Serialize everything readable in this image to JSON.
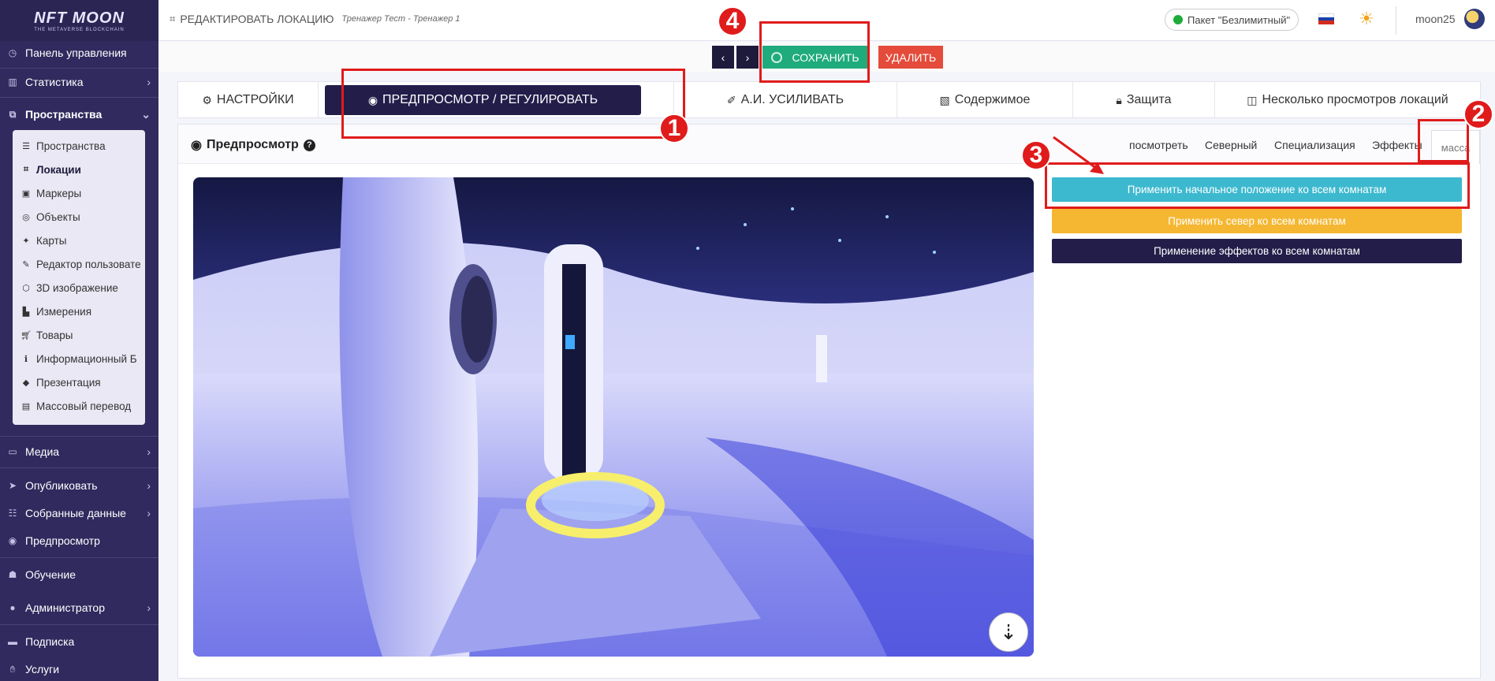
{
  "logo": {
    "main": "NFT MOON",
    "sub": "THE METAVERSE BLOCKCHAIN"
  },
  "sidebar": {
    "items": [
      {
        "label": "Панель управления",
        "icon": "dashboard-icon"
      },
      {
        "label": "Статистика",
        "icon": "chart-icon"
      },
      {
        "label": "Пространства",
        "icon": "sitemap-icon"
      },
      {
        "label": "Медиа",
        "icon": "monitor-icon"
      },
      {
        "label": "Опубликовать",
        "icon": "paper-plane-icon"
      },
      {
        "label": "Собранные данные",
        "icon": "database-icon"
      },
      {
        "label": "Предпросмотр",
        "icon": "eye-icon"
      },
      {
        "label": "Обучение",
        "icon": "users-icon"
      },
      {
        "label": "Администратор",
        "icon": "user-icon"
      },
      {
        "label": "Подписка",
        "icon": "card-icon"
      },
      {
        "label": "Услуги",
        "icon": "hand-icon"
      }
    ],
    "submenu": [
      {
        "label": "Пространства",
        "icon": "list-icon"
      },
      {
        "label": "Локации",
        "icon": "location-icon"
      },
      {
        "label": "Маркеры",
        "icon": "image-icon"
      },
      {
        "label": "Объекты",
        "icon": "circle-icon"
      },
      {
        "label": "Карты",
        "icon": "map-icon"
      },
      {
        "label": "Редактор пользовате",
        "icon": "edit-icon"
      },
      {
        "label": "3D изображение",
        "icon": "cube-icon"
      },
      {
        "label": "Измерения",
        "icon": "ruler-icon"
      },
      {
        "label": "Товары",
        "icon": "cart-icon"
      },
      {
        "label": "Информационный Б",
        "icon": "info-icon"
      },
      {
        "label": "Презентация",
        "icon": "diamond-icon"
      },
      {
        "label": "Массовый перевод",
        "icon": "id-card-icon"
      }
    ]
  },
  "header": {
    "title": "РЕДАКТИРОВАТЬ ЛОКАЦИЮ",
    "subtitle": "Тренажер Тест - Тренажер 1",
    "package": "Пакет \"Безлимитный\"",
    "username": "moon25"
  },
  "actions": {
    "prev": "‹",
    "next": "›",
    "save": "СОХРАНИТЬ",
    "delete": "УДАЛИТЬ"
  },
  "tabs": [
    {
      "label": "НАСТРОЙКИ",
      "icon": "cogs-icon"
    },
    {
      "label": "ПРЕДПРОСМОТР / РЕГУЛИРОВАТЬ",
      "icon": "eye-icon"
    },
    {
      "label": "А.И. УСИЛИВАТЬ",
      "icon": "magic-brush-icon"
    },
    {
      "label": "Содержимое",
      "icon": "images-icon"
    },
    {
      "label": "Защита",
      "icon": "lock-icon"
    },
    {
      "label": "Несколько просмотров локаций",
      "icon": "columns-icon"
    }
  ],
  "panel": {
    "title": "Предпросмотр",
    "subtabs": [
      "посмотреть",
      "Северный",
      "Специализация",
      "Эффекты",
      "масса"
    ]
  },
  "mass_buttons": [
    "Применить начальное положение ко всем комнатам",
    "Применить север ко всем комнатам",
    "Применение эффектов ко всем комнатам"
  ],
  "annotations": [
    "1",
    "2",
    "3",
    "4"
  ],
  "colors": {
    "sidebar": "#312a5e",
    "primary_dark": "#231d4a",
    "save_green": "#1fab7b",
    "delete_red": "#e44b3a",
    "teal": "#3db9cf",
    "yellow": "#f5b731",
    "annotation_red": "#e01b1b"
  }
}
